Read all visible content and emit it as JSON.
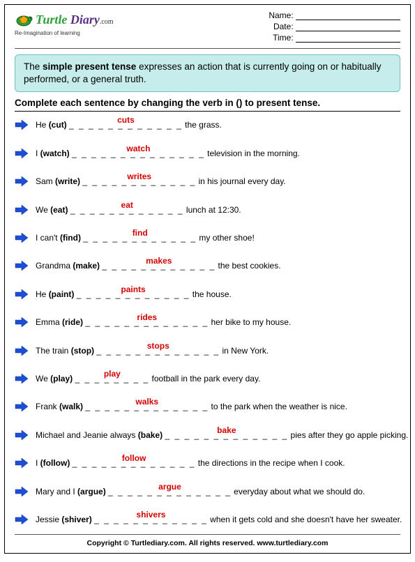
{
  "header": {
    "logo_word1": "Turtle",
    "logo_word2": "Diary",
    "logo_dotcom": ".com",
    "tagline": "Re-Imagination of learning",
    "name_label": "Name:",
    "date_label": "Date:",
    "time_label": "Time:"
  },
  "info_html": "The <b>simple present tense</b> expresses an action that is currently going on or habitually performed, or a general truth.",
  "instruction": "Complete each sentence by changing the verb in () to present tense.",
  "items": [
    {
      "pre": "He ",
      "verb": "(cut)",
      "blank": "_ _ _ _ _ _ _ _ _ _ _ _",
      "answer": "cuts",
      "post": " the grass."
    },
    {
      "pre": "I ",
      "verb": "(watch)",
      "blank": "_ _ _ _ _ _ _ _ _ _ _ _ _ _",
      "answer": "watch",
      "post": " television in the morning."
    },
    {
      "pre": "Sam ",
      "verb": "(write)",
      "blank": "_ _ _ _ _ _ _ _ _ _ _ _",
      "answer": "writes",
      "post": " in his journal every day."
    },
    {
      "pre": "We ",
      "verb": "(eat)",
      "blank": "_ _ _ _ _ _ _ _ _ _ _ _",
      "answer": "eat",
      "post": "  lunch at 12:30."
    },
    {
      "pre": "I can't ",
      "verb": "(find)",
      "blank": "_ _ _ _ _ _ _ _ _ _ _ _",
      "answer": "find",
      "post": " my other shoe!"
    },
    {
      "pre": "Grandma ",
      "verb": "(make)",
      "blank": "_ _ _ _ _ _ _ _ _ _ _ _",
      "answer": "makes",
      "post": " the best cookies."
    },
    {
      "pre": "He ",
      "verb": "(paint)",
      "blank": "_ _ _ _ _ _ _ _ _ _ _ _",
      "answer": "paints",
      "post": " the house."
    },
    {
      "pre": "Emma ",
      "verb": "(ride)",
      "blank": "_ _ _ _ _ _ _ _ _ _ _ _ _",
      "answer": "rides",
      "post": " her bike to my house."
    },
    {
      "pre": "The train ",
      "verb": "(stop)",
      "blank": "_ _ _ _ _ _ _ _ _ _ _ _ _",
      "answer": "stops",
      "post": " in New York."
    },
    {
      "pre": "We ",
      "verb": "(play)",
      "blank": "_ _ _ _ _ _ _ _",
      "answer": "play",
      "post": " football in the park every day."
    },
    {
      "pre": "Frank ",
      "verb": "(walk)",
      "blank": "_ _ _ _ _ _ _ _ _ _ _ _ _",
      "answer": "walks",
      "post": " to the park when the weather is nice."
    },
    {
      "pre": "Michael and Jeanie always ",
      "verb": "(bake)",
      "blank": "_ _ _ _ _ _ _ _ _ _ _ _ _",
      "answer": "bake",
      "post": " pies after they go apple picking."
    },
    {
      "pre": "I ",
      "verb": "(follow)",
      "blank": "_ _ _ _ _ _ _ _ _ _ _ _ _",
      "answer": "follow",
      "post": " the directions in the recipe when I cook."
    },
    {
      "pre": "Mary and I ",
      "verb": "(argue)",
      "blank": "_ _ _ _ _ _ _ _ _ _ _ _ _",
      "answer": "argue",
      "post": " everyday about what we should do."
    },
    {
      "pre": "Jessie ",
      "verb": "(shiver)",
      "blank": "_ _ _ _ _ _ _ _ _ _ _ _",
      "answer": "shivers",
      "post": " when it gets cold and she doesn't have her sweater."
    }
  ],
  "footer": "Copyright © Turtlediary.com. All rights reserved. www.turtlediary.com"
}
